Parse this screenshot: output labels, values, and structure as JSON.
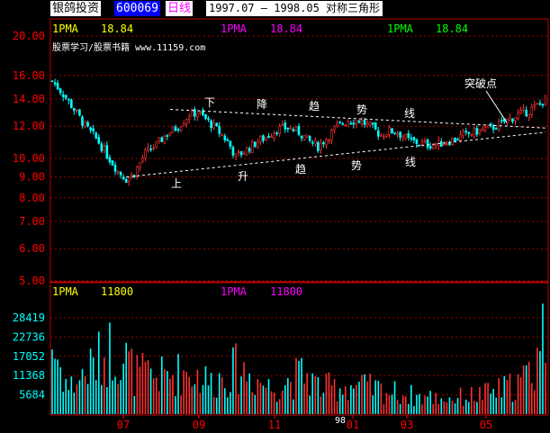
{
  "header": {
    "stock_name": "银鸽投资",
    "stock_code": "600069",
    "period": "日线",
    "title": "1997.07 — 1998.05 对称三角形"
  },
  "price_panel": {
    "ma_label_1": "1PMA",
    "ma_value_1": "18.84",
    "ma_label_2": "1PMA",
    "ma_value_2": "18.84",
    "ma_label_3": "1PMA",
    "ma_value_3": "18.84",
    "watermark": "股票学习/股票书籍 www.11159.com",
    "y_ticks": [
      "20.00",
      "16.00",
      "14.00",
      "12.00",
      "10.00",
      "9.00",
      "8.00",
      "7.00",
      "6.00",
      "5.00"
    ]
  },
  "volume_panel": {
    "ma_label_1": "1PMA",
    "ma_value_1": "11800",
    "ma_label_2": "1PMA",
    "ma_value_2": "11800",
    "y_ticks": [
      "28419",
      "22736",
      "17052",
      "11368",
      "5684"
    ]
  },
  "x_axis": {
    "ticks": [
      "07",
      "09",
      "11",
      "01",
      "03",
      "05"
    ],
    "year_marker": "98"
  },
  "annotations": {
    "upper_line": [
      "下",
      "降",
      "趋",
      "势",
      "线"
    ],
    "lower_line": [
      "上",
      "升",
      "趋",
      "势",
      "线"
    ],
    "breakout": "突破点"
  },
  "colors": {
    "up": "#ff3030",
    "down": "#00ffff",
    "ma1": "#ffff00",
    "ma2": "#ff00ff",
    "ma3": "#00ff00",
    "axis": "#ff0000"
  },
  "chart_data": {
    "type": "candlestick",
    "price_scale": "log",
    "ylim": [
      5,
      20
    ],
    "volume_ylim": [
      0,
      34000
    ],
    "series": [
      {
        "name": "1PMA",
        "values": [
          18.84
        ]
      }
    ],
    "close_keypoints": [
      [
        0,
        15.5
      ],
      [
        4,
        14.4
      ],
      [
        8,
        13.2
      ],
      [
        12,
        12.0
      ],
      [
        16,
        11.2
      ],
      [
        20,
        10.2
      ],
      [
        24,
        9.3
      ],
      [
        27,
        8.9
      ],
      [
        30,
        9.2
      ],
      [
        34,
        10.3
      ],
      [
        38,
        10.8
      ],
      [
        42,
        11.5
      ],
      [
        46,
        12.0
      ],
      [
        50,
        12.8
      ],
      [
        53,
        13.0
      ],
      [
        56,
        12.5
      ],
      [
        60,
        11.8
      ],
      [
        64,
        11.0
      ],
      [
        67,
        10.1
      ],
      [
        70,
        10.4
      ],
      [
        74,
        10.9
      ],
      [
        78,
        11.3
      ],
      [
        82,
        11.8
      ],
      [
        86,
        11.9
      ],
      [
        90,
        11.6
      ],
      [
        94,
        11.0
      ],
      [
        97,
        10.7
      ],
      [
        100,
        11.2
      ],
      [
        104,
        12.0
      ],
      [
        108,
        12.4
      ],
      [
        112,
        12.4
      ],
      [
        116,
        12.0
      ],
      [
        120,
        11.4
      ],
      [
        123,
        11.7
      ],
      [
        126,
        11.6
      ],
      [
        130,
        11.1
      ],
      [
        134,
        10.9
      ],
      [
        138,
        10.8
      ],
      [
        142,
        10.9
      ],
      [
        146,
        11.1
      ],
      [
        150,
        11.4
      ],
      [
        154,
        11.6
      ],
      [
        158,
        11.8
      ],
      [
        162,
        12.0
      ],
      [
        166,
        12.4
      ],
      [
        170,
        12.8
      ],
      [
        174,
        13.1
      ],
      [
        178,
        13.6
      ],
      [
        180,
        14.0
      ]
    ],
    "upper_trendline": {
      "from": [
        48,
        13.2
      ],
      "to": [
        180,
        12.0
      ]
    },
    "lower_trendline": {
      "from": [
        27,
        9.0
      ],
      "to": [
        180,
        11.6
      ]
    },
    "volume_keypoints": [
      [
        0,
        24000
      ],
      [
        6,
        9000
      ],
      [
        14,
        16000
      ],
      [
        22,
        23000
      ],
      [
        27,
        19000
      ],
      [
        30,
        14000
      ],
      [
        40,
        13000
      ],
      [
        50,
        15000
      ],
      [
        58,
        11000
      ],
      [
        68,
        16000
      ],
      [
        80,
        9000
      ],
      [
        92,
        14000
      ],
      [
        98,
        9000
      ],
      [
        110,
        10000
      ],
      [
        122,
        8000
      ],
      [
        134,
        6000
      ],
      [
        146,
        5500
      ],
      [
        158,
        7000
      ],
      [
        166,
        9000
      ],
      [
        172,
        12000
      ],
      [
        176,
        16000
      ],
      [
        178,
        26000
      ],
      [
        180,
        30000
      ]
    ]
  }
}
